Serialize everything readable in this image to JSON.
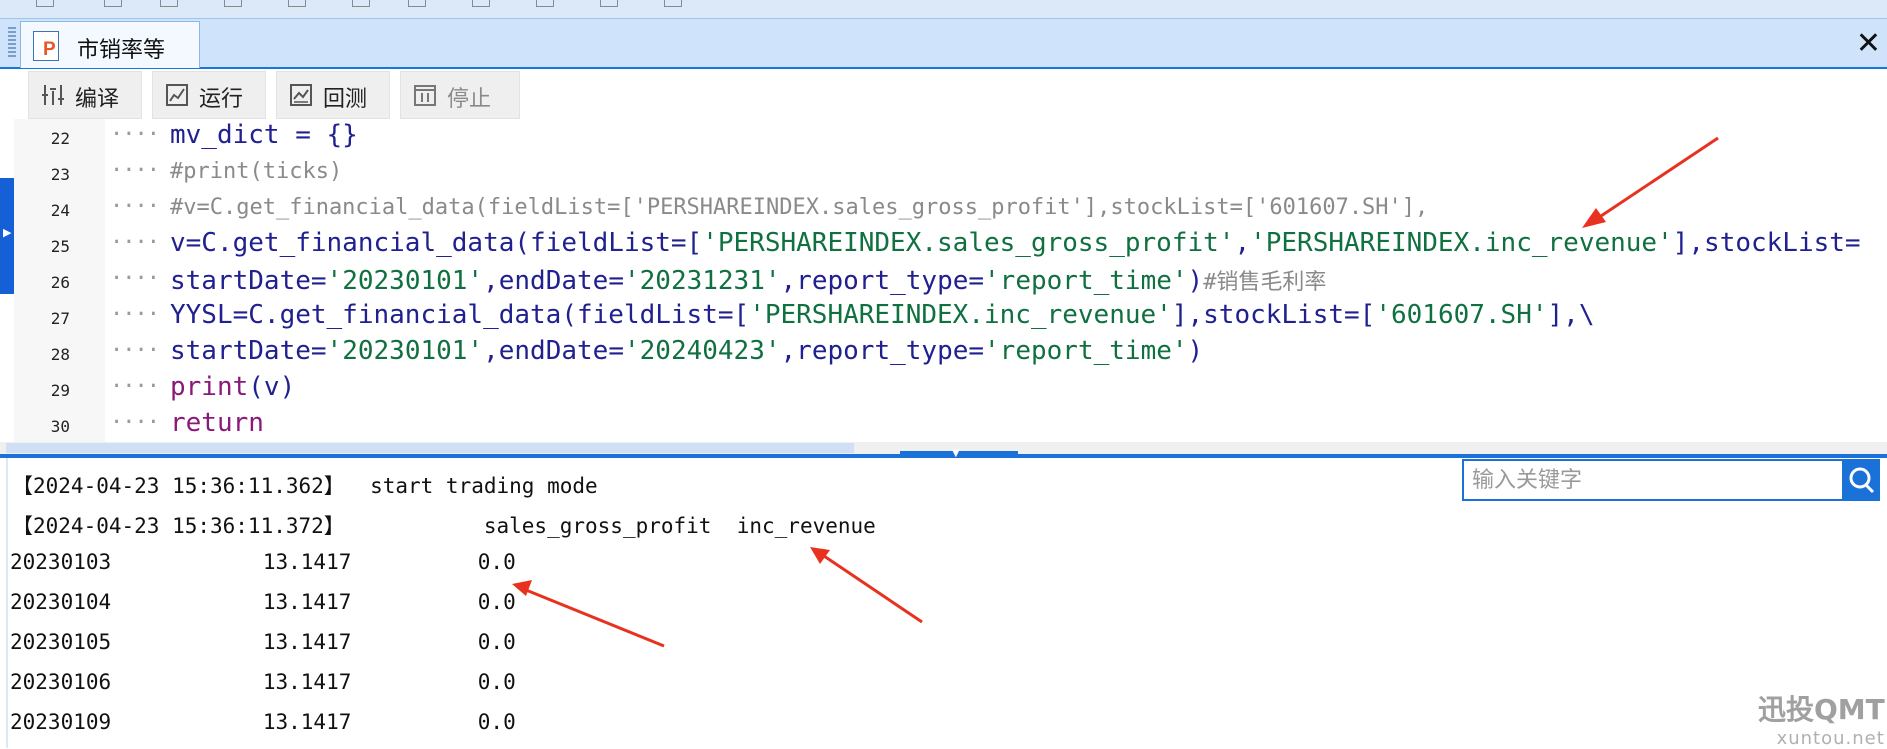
{
  "tab": {
    "title": "市销率等",
    "icon": "python-file-icon"
  },
  "toolbar": {
    "compile_label": "编译",
    "run_label": "运行",
    "backtest_label": "回测",
    "stop_label": "停止"
  },
  "editor": {
    "lines": [
      {
        "n": "22",
        "dots": "····",
        "parts": [
          [
            "mv_dict = {}",
            "plain"
          ]
        ]
      },
      {
        "n": "23",
        "dots": "····",
        "parts": [
          [
            "#print(ticks)",
            "cm"
          ]
        ]
      },
      {
        "n": "24",
        "dots": "····",
        "parts": [
          [
            "#v=C.get_financial_data(fieldList=['PERSHAREINDEX.sales_gross_profit'],stockList=['601607.SH'],",
            "cm"
          ]
        ]
      },
      {
        "n": "25",
        "dots": "····",
        "parts": [
          [
            "v=C.get_financial_data(fieldList=[",
            "plain"
          ],
          [
            "'PERSHAREINDEX.sales_gross_profit'",
            "str"
          ],
          [
            ",",
            "plain"
          ],
          [
            "'PERSHAREINDEX.inc_revenue'",
            "str"
          ],
          [
            "],stockList=",
            "plain"
          ]
        ]
      },
      {
        "n": "26",
        "dots": "····",
        "parts": [
          [
            "startDate=",
            "plain"
          ],
          [
            "'20230101'",
            "str"
          ],
          [
            ",endDate=",
            "plain"
          ],
          [
            "'20231231'",
            "str"
          ],
          [
            ",report_type=",
            "plain"
          ],
          [
            "'report_time'",
            "str"
          ],
          [
            ")",
            "plain"
          ],
          [
            "#销售毛利率",
            "cm"
          ]
        ]
      },
      {
        "n": "27",
        "dots": "····",
        "parts": [
          [
            "YYSL=C.get_financial_data(fieldList=[",
            "plain"
          ],
          [
            "'PERSHAREINDEX.inc_revenue'",
            "str"
          ],
          [
            "],stockList=[",
            "plain"
          ],
          [
            "'601607.SH'",
            "str"
          ],
          [
            "],\\",
            "plain"
          ]
        ]
      },
      {
        "n": "28",
        "dots": "····",
        "parts": [
          [
            "startDate=",
            "plain"
          ],
          [
            "'20230101'",
            "str"
          ],
          [
            ",endDate=",
            "plain"
          ],
          [
            "'20240423'",
            "str"
          ],
          [
            ",report_type=",
            "plain"
          ],
          [
            "'report_time'",
            "str"
          ],
          [
            ")",
            "plain"
          ]
        ]
      },
      {
        "n": "29",
        "dots": "····",
        "parts": [
          [
            "print",
            "kw"
          ],
          [
            "(v)",
            "plain"
          ]
        ]
      },
      {
        "n": "30",
        "dots": "····",
        "parts": [
          [
            "return",
            "kw"
          ]
        ]
      }
    ]
  },
  "output": {
    "lines": [
      "【2024-04-23 15:36:11.362】  start trading mode",
      "【2024-04-23 15:36:11.372】           sales_gross_profit  inc_revenue",
      "20230103            13.1417          0.0",
      "20230104            13.1417          0.0",
      "20230105            13.1417          0.0",
      "20230106            13.1417          0.0",
      "20230109            13.1417          0.0"
    ]
  },
  "search": {
    "placeholder": "输入关键字"
  },
  "watermark": {
    "brand": "迅投QMT",
    "url": "xuntou.net"
  },
  "colors": {
    "accent": "#1a72d8",
    "annotation_arrow": "#e8321f",
    "string": "#107040",
    "keyword": "#8a1a7a",
    "comment": "#8a8a8a"
  }
}
